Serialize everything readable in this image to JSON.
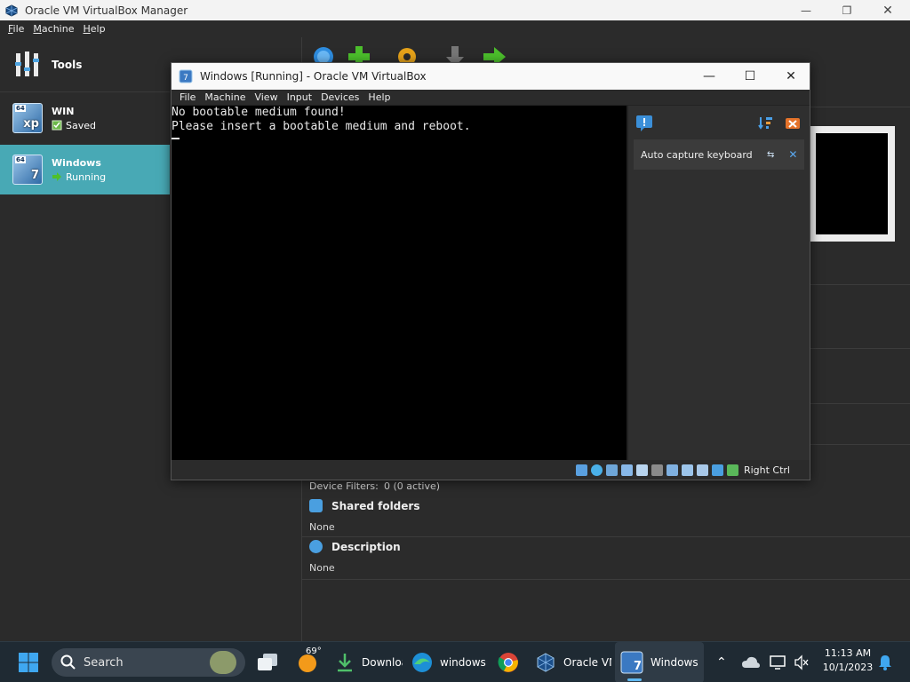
{
  "manager": {
    "title": "Oracle VM VirtualBox Manager",
    "menu": [
      "File",
      "Machine",
      "Help"
    ],
    "tools_label": "Tools",
    "vms": [
      {
        "name": "WIN",
        "state": "Saved",
        "badge": "64",
        "ver": "xp"
      },
      {
        "name": "Windows",
        "state": "Running",
        "badge": "64",
        "ver": "7"
      }
    ],
    "details": {
      "device_filters_label": "Device Filters:",
      "device_filters_value": "0 (0 active)",
      "shared_folders_title": "Shared folders",
      "shared_folders_value": "None",
      "description_title": "Description",
      "description_value": "None"
    },
    "colors": {
      "selected_row": "#48a9b5"
    }
  },
  "vm_window": {
    "title": "Windows  [Running] - Oracle VM VirtualBox",
    "menu": [
      "File",
      "Machine",
      "View",
      "Input",
      "Devices",
      "Help"
    ],
    "console_lines": [
      "No bootable medium found!",
      "Please insert a bootable medium and reboot."
    ],
    "notification": "Auto capture keyboard ...",
    "host_key": "Right Ctrl"
  },
  "taskbar": {
    "search_placeholder": "Search",
    "weather_temp": "69°",
    "items": [
      {
        "label": "Downloa",
        "icon": "download-icon"
      },
      {
        "label": "windows '",
        "icon": "edge-icon"
      },
      {
        "label": "",
        "icon": "chrome-icon"
      },
      {
        "label": "Oracle VM",
        "icon": "virtualbox-icon"
      },
      {
        "label": "Windows",
        "icon": "vm-windows-icon"
      }
    ],
    "time": "11:13 AM",
    "date": "10/1/2023"
  }
}
